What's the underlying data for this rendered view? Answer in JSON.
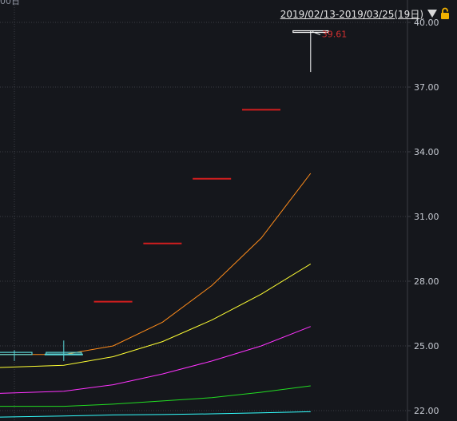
{
  "header": {
    "range_label": "2019/02/13-2019/03/25(19日)",
    "corner_cut_text": "00日"
  },
  "price_tag": "39.61",
  "chart_data": {
    "type": "line",
    "y_ticks": [
      "40.00",
      "37.00",
      "34.00",
      "31.00",
      "28.00",
      "25.00",
      "22.00"
    ],
    "ylim": [
      21.9,
      40.1
    ],
    "x": [
      0,
      1,
      2,
      3,
      4,
      5,
      6
    ],
    "series": [
      {
        "color": "#ff8c1a",
        "values": [
          24.6,
          24.6,
          25.0,
          26.1,
          27.8,
          30.0,
          33.0
        ]
      },
      {
        "color": "#ffff33",
        "values": [
          24.0,
          24.1,
          24.5,
          25.2,
          26.2,
          27.4,
          28.8
        ]
      },
      {
        "color": "#ff33ff",
        "values": [
          22.8,
          22.9,
          23.2,
          23.7,
          24.3,
          25.0,
          25.9
        ]
      },
      {
        "color": "#22dd22",
        "values": [
          22.2,
          22.2,
          22.3,
          22.45,
          22.6,
          22.85,
          23.15
        ]
      },
      {
        "color": "#33ffff",
        "values": [
          21.7,
          21.75,
          21.8,
          21.82,
          21.85,
          21.9,
          21.95
        ]
      }
    ],
    "dash_levels": [
      {
        "x": 1,
        "value": 24.6,
        "color": "#5ad6d6"
      },
      {
        "x": 2,
        "value": 27.05,
        "color": "#d21e1e"
      },
      {
        "x": 3,
        "value": 29.75,
        "color": "#d21e1e"
      },
      {
        "x": 4,
        "value": 32.75,
        "color": "#d21e1e"
      },
      {
        "x": 5,
        "value": 35.95,
        "color": "#d21e1e"
      }
    ],
    "candles": [
      {
        "x": 0,
        "open": 24.6,
        "close": 24.7,
        "high": 24.8,
        "low": 24.3,
        "color": "#5ad6d6"
      },
      {
        "x": 1,
        "open": 24.65,
        "close": 24.7,
        "high": 25.25,
        "low": 24.3,
        "color": "#5ad6d6"
      },
      {
        "x": 6,
        "open": 39.61,
        "close": 39.61,
        "high": 39.61,
        "low": 37.7,
        "color": "#ffffff"
      }
    ],
    "grid": true
  },
  "colors": {
    "background": "#15171c",
    "grid": "#3a3d45",
    "axis_text": "#c7cbd3",
    "price_tag": "#d23030"
  },
  "icons": {
    "dropdown": "triangle-down-icon",
    "lock": "lock-icon"
  }
}
